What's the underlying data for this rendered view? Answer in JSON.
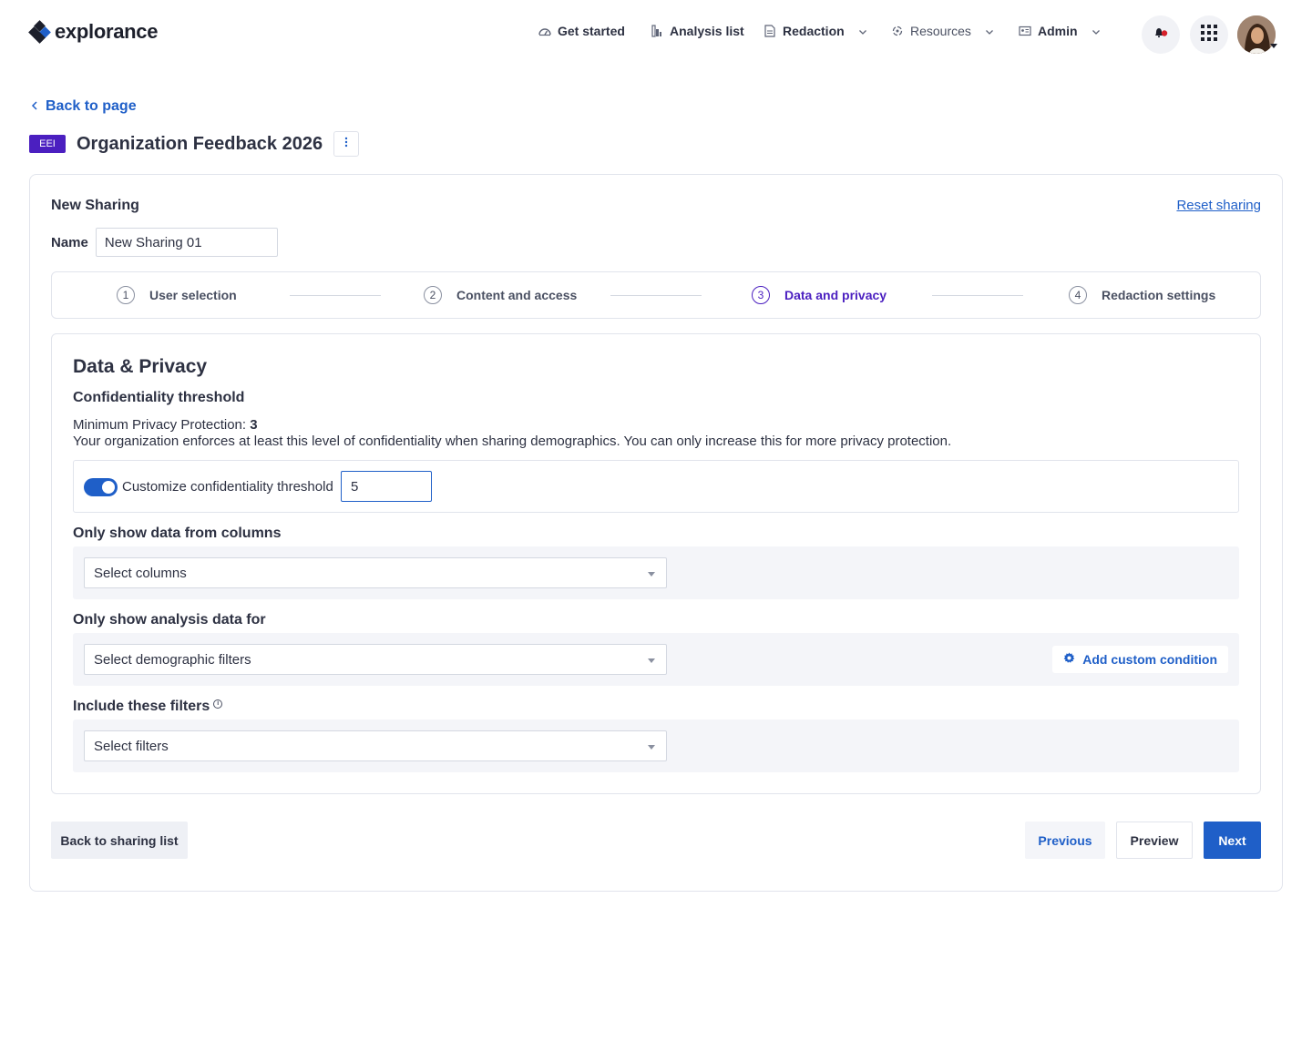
{
  "brand": {
    "name": "explorance",
    "accent": "#1f5fc8",
    "badge_color": "#4b1fc0"
  },
  "nav": {
    "items": [
      {
        "label": "Get started",
        "icon": "gauge-icon"
      },
      {
        "label": "Analysis list",
        "icon": "chart-icon"
      },
      {
        "label": "Redaction",
        "icon": "document-icon",
        "dropdown": true
      },
      {
        "label": "Resources",
        "icon": "resources-icon",
        "dropdown": true
      },
      {
        "label": "Admin",
        "icon": "admin-icon",
        "dropdown": true
      }
    ]
  },
  "header": {
    "back_label": "Back to page",
    "badge": "EEI",
    "title": "Organization Feedback 2026"
  },
  "sharing": {
    "label": "New Sharing",
    "reset_label": "Reset sharing",
    "name_label": "Name",
    "name_value": "New Sharing 01"
  },
  "steps": [
    {
      "num": "1",
      "label": "User selection"
    },
    {
      "num": "2",
      "label": "Content and access"
    },
    {
      "num": "3",
      "label": "Data and privacy",
      "active": true
    },
    {
      "num": "4",
      "label": "Redaction settings"
    }
  ],
  "privacy": {
    "heading": "Data & Privacy",
    "threshold_heading": "Confidentiality threshold",
    "min_label": "Minimum Privacy Protection: ",
    "min_value": "3",
    "description": "Your organization enforces at least this level of confidentiality when sharing demographics. You can only increase this for more privacy protection.",
    "toggle_label": "Customize confidentiality threshold",
    "threshold_value": "5",
    "columns_heading": "Only show data from columns",
    "columns_placeholder": "Select columns",
    "analysis_heading": "Only show analysis data for",
    "analysis_placeholder": "Select demographic filters",
    "custom_condition_label": "Add custom condition",
    "filters_heading": "Include these filters",
    "filters_placeholder": "Select filters"
  },
  "footer": {
    "back_label": "Back to sharing list",
    "previous_label": "Previous",
    "preview_label": "Preview",
    "next_label": "Next"
  }
}
